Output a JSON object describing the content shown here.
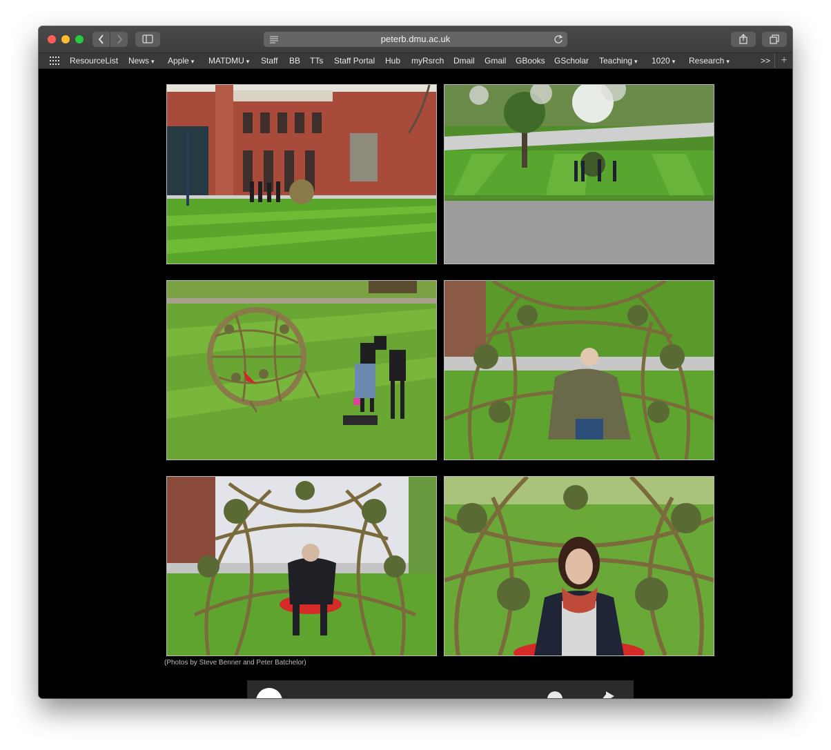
{
  "browser": {
    "url": "peterb.dmu.ac.uk",
    "bookmarks": [
      {
        "label": "ResourceList",
        "dropdown": false
      },
      {
        "label": "News",
        "dropdown": true
      },
      {
        "label": "Apple",
        "dropdown": true
      },
      {
        "label": "MATDMU",
        "dropdown": true
      },
      {
        "label": "Staff",
        "dropdown": false
      },
      {
        "label": "BB",
        "dropdown": false
      },
      {
        "label": "TTs",
        "dropdown": false
      },
      {
        "label": "Staff Portal",
        "dropdown": false
      },
      {
        "label": "Hub",
        "dropdown": false
      },
      {
        "label": "myRsrch",
        "dropdown": false
      },
      {
        "label": "Dmail",
        "dropdown": false
      },
      {
        "label": "Gmail",
        "dropdown": false
      },
      {
        "label": "GBooks",
        "dropdown": false
      },
      {
        "label": "GScholar",
        "dropdown": false
      },
      {
        "label": "Teaching",
        "dropdown": true
      },
      {
        "label": "1020",
        "dropdown": true
      },
      {
        "label": "Research",
        "dropdown": true
      }
    ],
    "more_label": ">>",
    "chevron": "⌄"
  },
  "page": {
    "photos": [
      {
        "id": "photo-1",
        "icon": "quad-building-lawn-scene"
      },
      {
        "id": "photo-2",
        "icon": "lawn-tree-path-scene"
      },
      {
        "id": "photo-3",
        "icon": "willow-sphere-lawn-scene"
      },
      {
        "id": "photo-4",
        "icon": "woman-seated-in-sphere-scene"
      },
      {
        "id": "photo-5",
        "icon": "man-seated-in-sphere-scene"
      },
      {
        "id": "photo-6",
        "icon": "woman-scarf-in-sphere-scene"
      }
    ],
    "caption": "(Photos by Steve Benner and Peter Batchelor)"
  },
  "colors": {
    "page_bg": "#000000",
    "grass": "#5f9a2c",
    "brick": "#9b4a3c"
  }
}
